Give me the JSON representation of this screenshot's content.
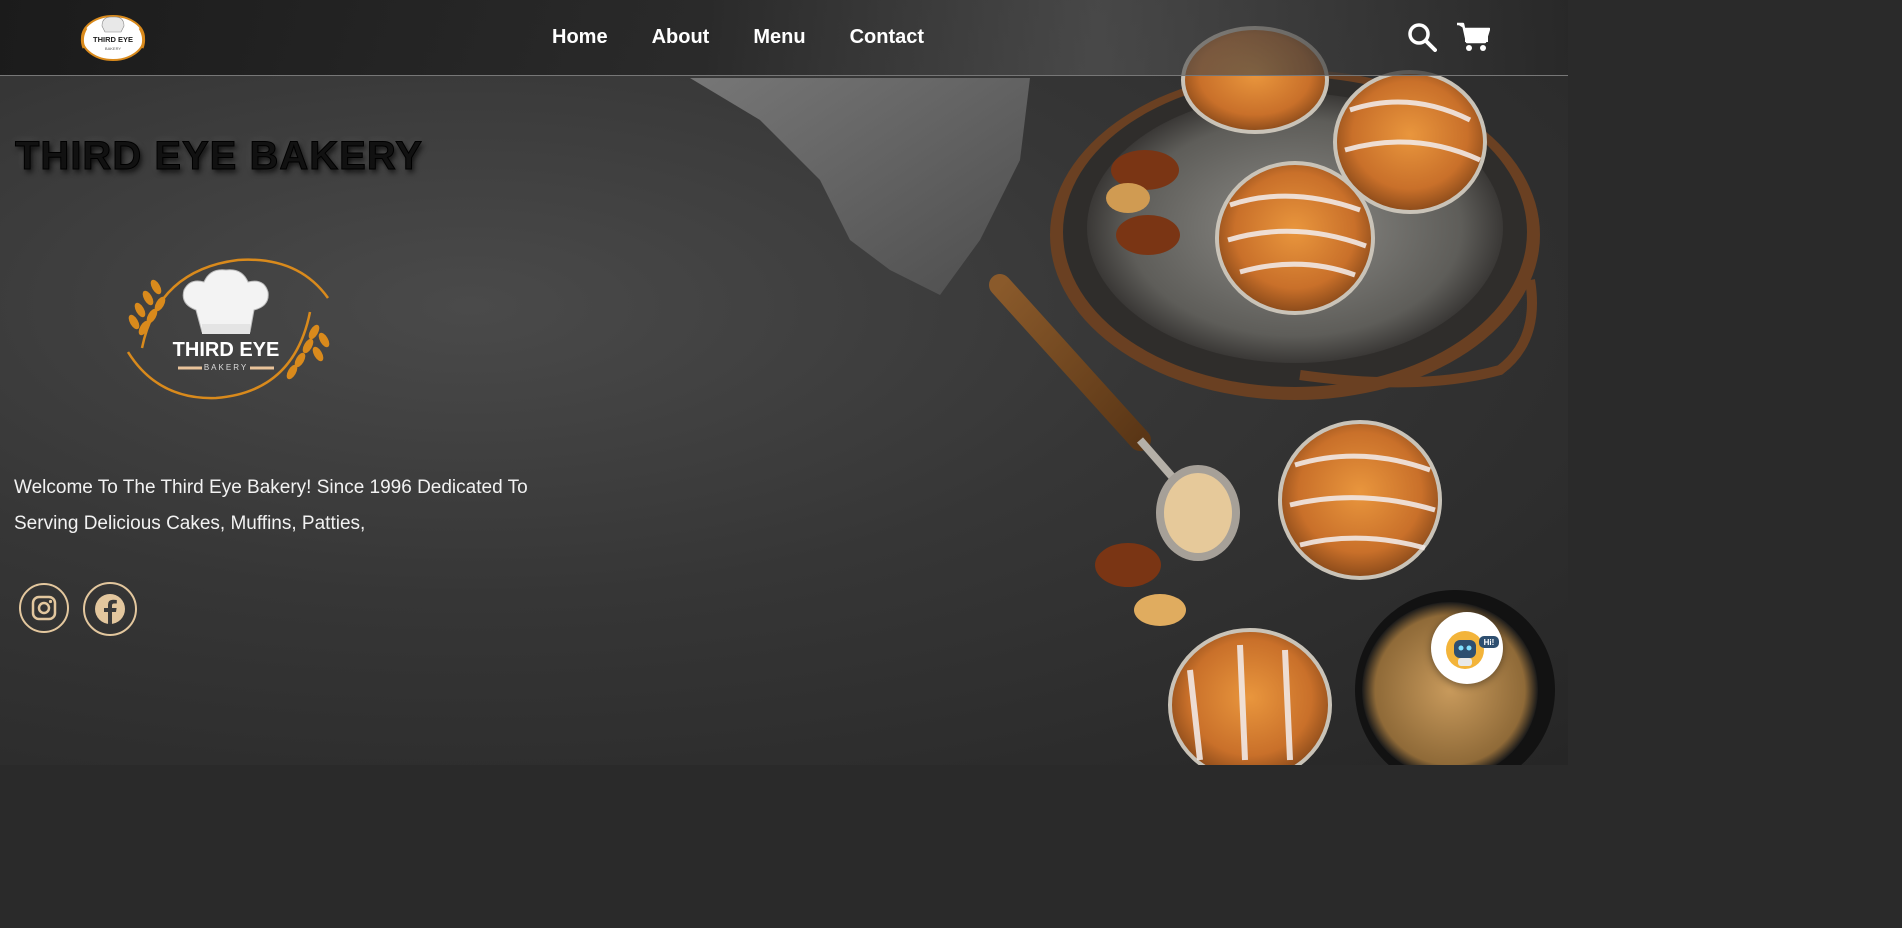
{
  "nav": {
    "logo_alt": "Third Eye Bakery",
    "links": [
      "Home",
      "About",
      "Menu",
      "Contact"
    ]
  },
  "hero": {
    "title": "THIRD EYE BAKERY",
    "welcome": "Welcome To The Third Eye Bakery! Since 1996 Dedicated To Serving Delicious Cakes, Muffins, Patties,"
  },
  "logo": {
    "line1": "THIRD EYE",
    "line2": "BAKERY"
  },
  "chatbot": {
    "badge": "Hi!"
  },
  "icons": {
    "search": "search-icon",
    "cart": "cart-icon",
    "instagram": "instagram-icon",
    "facebook": "facebook-icon"
  },
  "colors": {
    "accent": "#e3c79e",
    "logo_gold": "#d98a1c",
    "nav_text": "#ffffff"
  }
}
